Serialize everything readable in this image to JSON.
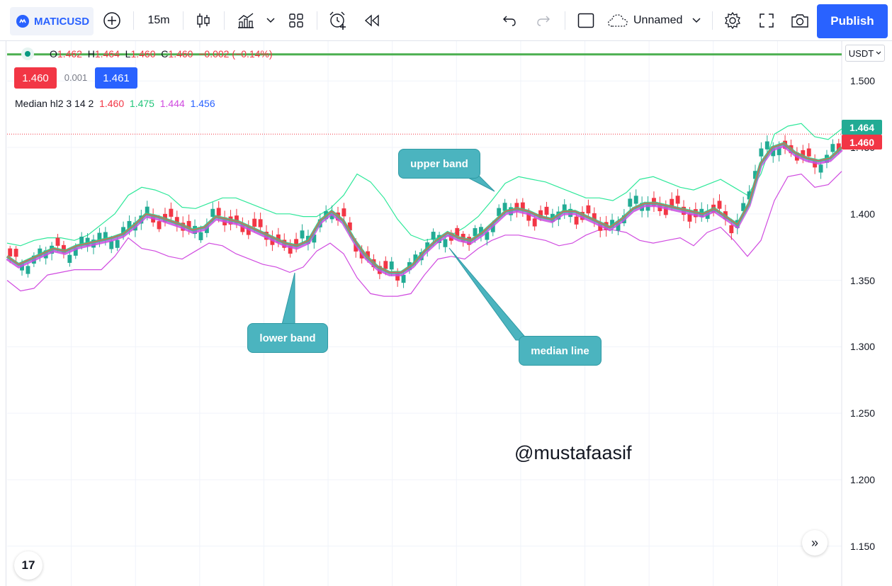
{
  "toolbar": {
    "symbol": "MATICUSD",
    "interval": "15m",
    "layout_name": "Unnamed",
    "publish_label": "Publish"
  },
  "legend": {
    "ohlc": {
      "open_label": "O",
      "open": "1.462",
      "high_label": "H",
      "high": "1.464",
      "low_label": "L",
      "low": "1.460",
      "close_label": "C",
      "close": "1.460",
      "change": "−0.002 (−0.14%)"
    },
    "bid": "1.460",
    "spread": "0.001",
    "ask": "1.461",
    "indicator": {
      "name": "Median hl2 3 14 2",
      "v1": "1.460",
      "v2": "1.475",
      "v3": "1.444",
      "v4": "1.456"
    }
  },
  "price_axis": {
    "currency": "USDT",
    "ticks": [
      "1.500",
      "1.450",
      "1.400",
      "1.350",
      "1.300",
      "1.250",
      "1.200",
      "1.150"
    ],
    "upper_tag": "1.464",
    "last_price_tag": "1.460"
  },
  "annotations": {
    "upper_band": "upper band",
    "lower_band": "lower band",
    "median_line": "median line"
  },
  "watermark": "@mustafaasif",
  "logo_text": "17",
  "colors": {
    "accent": "#2962ff",
    "up": "#22ab94",
    "down": "#f23645",
    "upper_band": "#2ee89a",
    "lower_band": "#d04be0",
    "callout": "#4bb4bf"
  },
  "chart_data": {
    "type": "candlestick",
    "price_range": [
      1.12,
      1.53
    ],
    "last_price": 1.46,
    "bid_line_price": 1.52,
    "median_line": [
      1.368,
      1.362,
      1.366,
      1.37,
      1.374,
      1.372,
      1.376,
      1.378,
      1.38,
      1.382,
      1.385,
      1.392,
      1.4,
      1.398,
      1.395,
      1.392,
      1.388,
      1.39,
      1.398,
      1.396,
      1.394,
      1.39,
      1.386,
      1.382,
      1.378,
      1.376,
      1.38,
      1.395,
      1.402,
      1.395,
      1.38,
      1.368,
      1.36,
      1.356,
      1.356,
      1.362,
      1.372,
      1.38,
      1.386,
      1.382,
      1.38,
      1.386,
      1.394,
      1.402,
      1.404,
      1.402,
      1.398,
      1.396,
      1.402,
      1.402,
      1.398,
      1.394,
      1.39,
      1.396,
      1.404,
      1.408,
      1.408,
      1.406,
      1.404,
      1.402,
      1.4,
      1.404,
      1.398,
      1.392,
      1.408,
      1.438,
      1.45,
      1.453,
      1.446,
      1.442,
      1.44,
      1.442,
      1.45
    ],
    "upper_band": [
      1.378,
      1.376,
      1.38,
      1.382,
      1.382,
      1.38,
      1.384,
      1.392,
      1.4,
      1.414,
      1.42,
      1.418,
      1.414,
      1.405,
      1.404,
      1.408,
      1.412,
      1.412,
      1.408,
      1.404,
      1.4,
      1.4,
      1.398,
      1.398,
      1.404,
      1.414,
      1.43,
      1.424,
      1.412,
      1.396,
      1.384,
      1.38,
      1.382,
      1.384,
      1.39,
      1.398,
      1.41,
      1.423,
      1.428,
      1.426,
      1.424,
      1.42,
      1.416,
      1.412,
      1.412,
      1.41,
      1.416,
      1.426,
      1.428,
      1.424,
      1.42,
      1.418,
      1.422,
      1.426,
      1.42,
      1.414,
      1.43,
      1.46,
      1.466,
      1.468,
      1.458,
      1.456,
      1.464
    ],
    "lower_band": [
      1.35,
      1.342,
      1.344,
      1.354,
      1.356,
      1.358,
      1.358,
      1.358,
      1.368,
      1.382,
      1.374,
      1.372,
      1.368,
      1.366,
      1.372,
      1.378,
      1.376,
      1.37,
      1.366,
      1.362,
      1.36,
      1.356,
      1.36,
      1.372,
      1.378,
      1.37,
      1.352,
      1.34,
      1.338,
      1.338,
      1.34,
      1.354,
      1.366,
      1.368,
      1.366,
      1.374,
      1.38,
      1.384,
      1.384,
      1.382,
      1.38,
      1.376,
      1.378,
      1.384,
      1.388,
      1.388,
      1.386,
      1.38,
      1.378,
      1.38,
      1.382,
      1.376,
      1.386,
      1.39,
      1.38,
      1.368,
      1.38,
      1.41,
      1.428,
      1.43,
      1.42,
      1.422,
      1.432
    ]
  }
}
